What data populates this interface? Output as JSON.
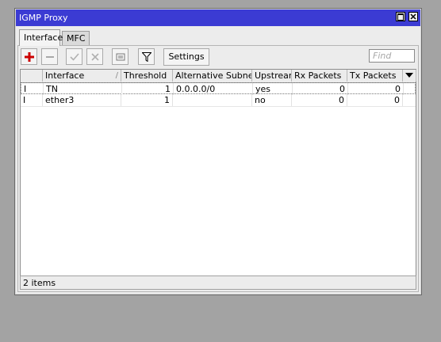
{
  "window": {
    "title": "IGMP Proxy"
  },
  "tabs": [
    {
      "label": "Interface"
    },
    {
      "label": "MFC"
    }
  ],
  "toolbar": {
    "icons": [
      "plus-icon",
      "minus-icon",
      "check-icon",
      "x-icon",
      "note-icon",
      "filter-icon"
    ],
    "settings_label": "Settings",
    "find_placeholder": "Find"
  },
  "table": {
    "columns": [
      "",
      "Interface",
      "Threshold",
      "Alternative Subnets",
      "Upstream",
      "Rx Packets",
      "Tx Packets"
    ],
    "rows": [
      {
        "flag": "I",
        "interface": "TN",
        "threshold": "1",
        "alt_subnets": "0.0.0.0/0",
        "upstream": "yes",
        "rx": "0",
        "tx": "0"
      },
      {
        "flag": "I",
        "interface": "ether3",
        "threshold": "1",
        "alt_subnets": "",
        "upstream": "no",
        "rx": "0",
        "tx": "0"
      }
    ]
  },
  "status": {
    "items": "2 items"
  },
  "colors": {
    "titlebar": "#3b3bd3",
    "background": "#a3a3a3",
    "add_icon": "#cc0000"
  }
}
